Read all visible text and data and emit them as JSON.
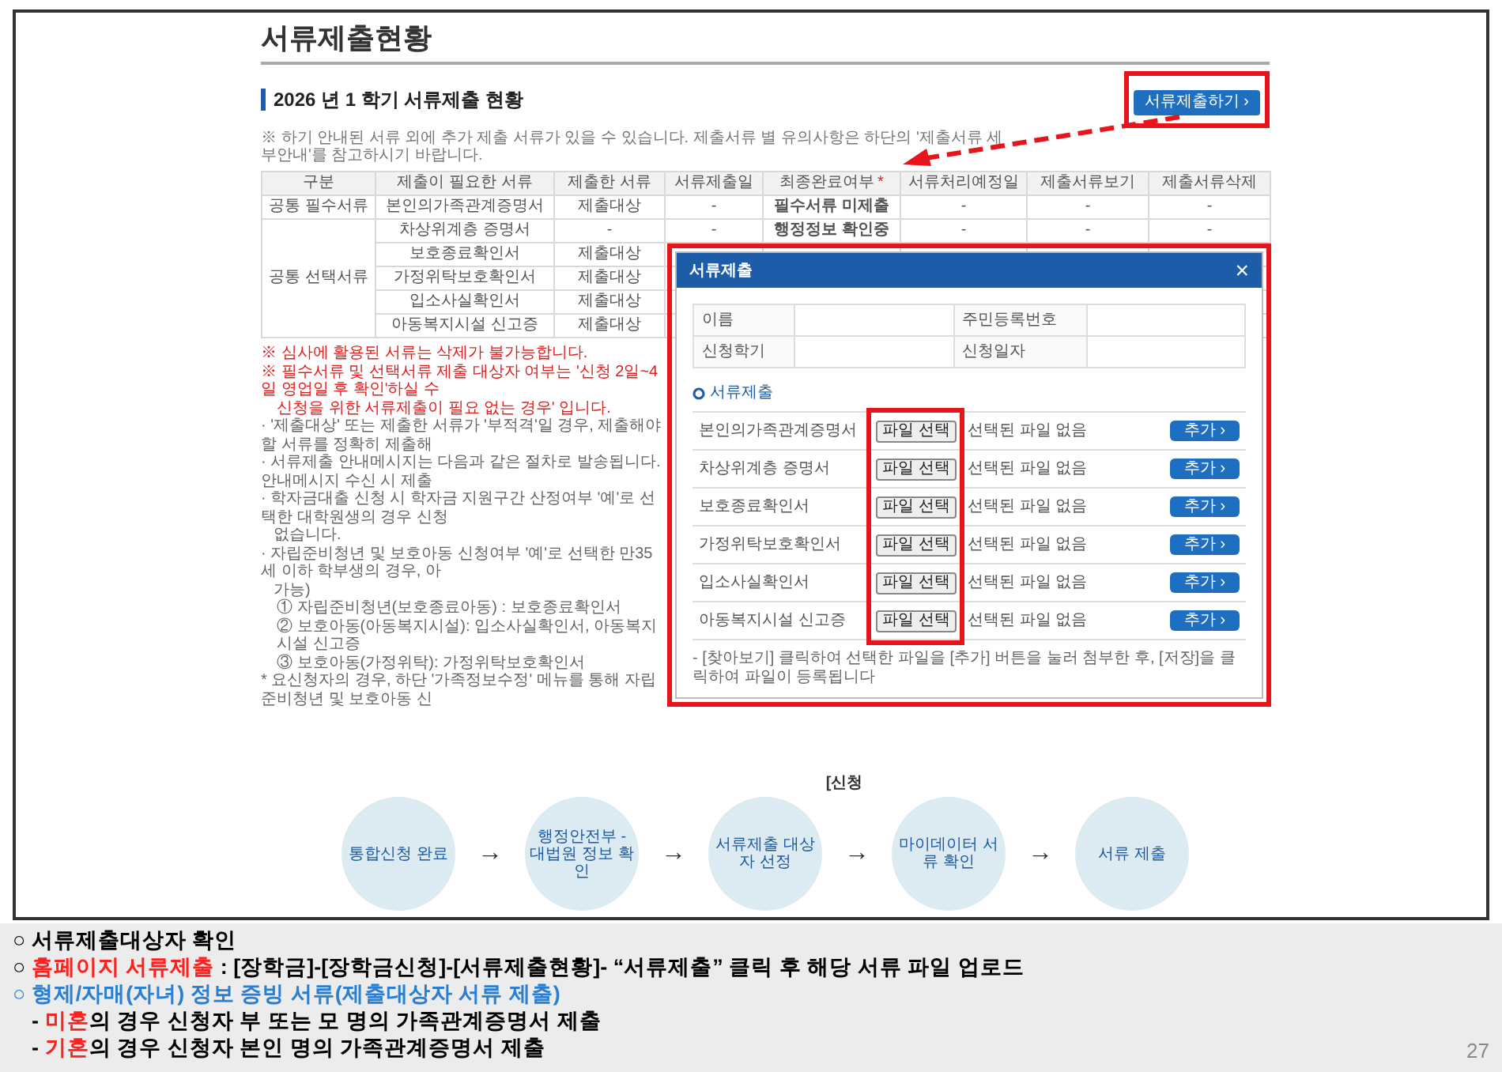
{
  "page": {
    "title": "서류제출현황",
    "section_title": "2026 년 1 학기 서류제출 현황",
    "submit_button": "서류제출하기 ›",
    "notice": "※ 하기 안내된 서류 외에 추가 제출 서류가 있을 수 있습니다. 제출서류 별 유의사항은 하단의 '제출서류 세부안내'를 참고하시기 바랍니다.",
    "table": {
      "columns": [
        {
          "label": "구분"
        },
        {
          "label": "제출이 필요한 서류"
        },
        {
          "label": "제출한 서류"
        },
        {
          "label": "서류제출일"
        },
        {
          "label": "최종완료여부",
          "marker": "*"
        },
        {
          "label": "서류처리예정일"
        },
        {
          "label": "제출서류보기"
        },
        {
          "label": "제출서류삭제"
        }
      ],
      "groups": [
        {
          "label": "공통 필수서류",
          "rows": [
            [
              "본인의가족관계증명서",
              "제출대상",
              "-",
              "필수서류 미제출",
              "-",
              "-",
              "-"
            ]
          ]
        },
        {
          "label": "공통 선택서류",
          "rows": [
            [
              "차상위계층 증명서",
              "-",
              "-",
              "행정정보 확인중",
              "-",
              "-",
              "-"
            ],
            [
              "보호종료확인서",
              "제출대상"
            ],
            [
              "가정위탁보호확인서",
              "제출대상"
            ],
            [
              "입소사실확인서",
              "제출대상"
            ],
            [
              "아동복지시설 신고증",
              "제출대상"
            ]
          ]
        }
      ]
    },
    "notes": [
      {
        "kind": "warning",
        "text": "※ 심사에 활용된 서류는 삭제가 불가능합니다."
      },
      {
        "kind": "warning",
        "text": "※ 필수서류 및 선택서류 제출 대상자 여부는 '신청 2일~4일 영업일 후 확인'하실 수"
      },
      {
        "kind": "warning-wrap",
        "text": "신청을 위한 서류제출이 필요 없는 경우' 입니다."
      },
      {
        "kind": "bullet",
        "text": "· '제출대상' 또는 제출한 서류가 '부적격'일 경우, 제출해야 할 서류를 정확히 제출해"
      },
      {
        "kind": "bullet",
        "text": "· 서류제출 안내메시지는 다음과 같은 절차로 발송됩니다. 안내메시지 수신 시 제출"
      },
      {
        "kind": "bullet",
        "text": "· 학자금대출 신청 시 학자금 지원구간 산정여부 '예'로 선택한 대학원생의 경우 신청"
      },
      {
        "kind": "bullet-wrap",
        "text": "없습니다."
      },
      {
        "kind": "bullet",
        "text": "· 자립준비청년 및 보호아동 신청여부 '예'로 선택한 만35세 이하 학부생의 경우, 아"
      },
      {
        "kind": "bullet-wrap",
        "text": "가능)"
      },
      {
        "kind": "numbered",
        "text": "① 자립준비청년(보호종료아동) : 보호종료확인서"
      },
      {
        "kind": "numbered",
        "text": "② 보호아동(아동복지시설): 입소사실확인서, 아동복지시설 신고증"
      },
      {
        "kind": "numbered",
        "text": "③ 보호아동(가정위탁): 가정위탁보호확인서"
      },
      {
        "kind": "bullet",
        "text": "* 요신청자의 경우, 하단 '가족정보수정' 메뉴를 통해 자립준비청년 및 보호아동 신"
      }
    ],
    "flow": {
      "caption": "[신청",
      "items": [
        {
          "kind": "step",
          "label": "통합신청 완료"
        },
        {
          "kind": "arrow",
          "label": "→"
        },
        {
          "kind": "step",
          "label": "행정안전부 - 대법원 정보 확인"
        },
        {
          "kind": "arrow",
          "label": "→"
        },
        {
          "kind": "step",
          "label": "서류제출 대상자 선정"
        },
        {
          "kind": "arrow",
          "label": "→"
        },
        {
          "kind": "step",
          "label": "마이데이터 서류 확인"
        },
        {
          "kind": "arrow",
          "label": "→"
        },
        {
          "kind": "step",
          "label": "서류 제출"
        }
      ]
    },
    "dialog": {
      "title": "서류제출",
      "close": "×",
      "info": [
        {
          "label": "이름"
        },
        {
          "label": "주민등록번호"
        },
        {
          "label": "신청학기"
        },
        {
          "label": "신청일자"
        }
      ],
      "section": "서류제출",
      "files": [
        {
          "label": "본인의가족관계증명서",
          "choose": "파일 선택",
          "status": "선택된 파일 없음",
          "add": "추가 ›"
        },
        {
          "label": "차상위계층 증명서",
          "choose": "파일 선택",
          "status": "선택된 파일 없음",
          "add": "추가 ›"
        },
        {
          "label": "보호종료확인서",
          "choose": "파일 선택",
          "status": "선택된 파일 없음",
          "add": "추가 ›"
        },
        {
          "label": "가정위탁보호확인서",
          "choose": "파일 선택",
          "status": "선택된 파일 없음",
          "add": "추가 ›"
        },
        {
          "label": "입소사실확인서",
          "choose": "파일 선택",
          "status": "선택된 파일 없음",
          "add": "추가 ›"
        },
        {
          "label": "아동복지시설 신고증",
          "choose": "파일 선택",
          "status": "선택된 파일 없음",
          "add": "추가 ›"
        }
      ],
      "footnote": "- [찾아보기] 클릭하여 선택한 파일을 [추가] 버튼을 눌러 첨부한 후, [저장]을 클릭하여 파일이 등록됩니다"
    }
  },
  "slide": {
    "lines": [
      {
        "highlighted": false,
        "kind": "item",
        "segments": [
          {
            "text": "○ 서류제출대상자 확인",
            "emphasis": false
          }
        ]
      },
      {
        "highlighted": false,
        "kind": "item",
        "segments": [
          {
            "text": "○ ",
            "emphasis": false
          },
          {
            "text": "홈페이지 서류제출",
            "emphasis": true
          },
          {
            "text": " : [장학금]-[장학금신청]-[서류제출현황]- “서류제출” 클릭 후 해당 서류 파일 업로드",
            "emphasis": false
          }
        ]
      },
      {
        "highlighted": true,
        "kind": "item",
        "segments": [
          {
            "text": "○ 형제/자매(자녀) 정보 증빙 서류(제출대상자 서류 제출)",
            "emphasis": false
          }
        ]
      },
      {
        "highlighted": false,
        "kind": "subitem",
        "segments": [
          {
            "text": "- ",
            "emphasis": false
          },
          {
            "text": "미혼",
            "emphasis": true
          },
          {
            "text": "의 경우 신청자 부 또는 모 명의 가족관계증명서 제출",
            "emphasis": false
          }
        ]
      },
      {
        "highlighted": false,
        "kind": "subitem",
        "segments": [
          {
            "text": "- ",
            "emphasis": false
          },
          {
            "text": "기혼",
            "emphasis": true
          },
          {
            "text": "의 경우 신청자 본인 명의 가족관계증명서 제출",
            "emphasis": false
          }
        ]
      }
    ],
    "page_number": "27"
  }
}
